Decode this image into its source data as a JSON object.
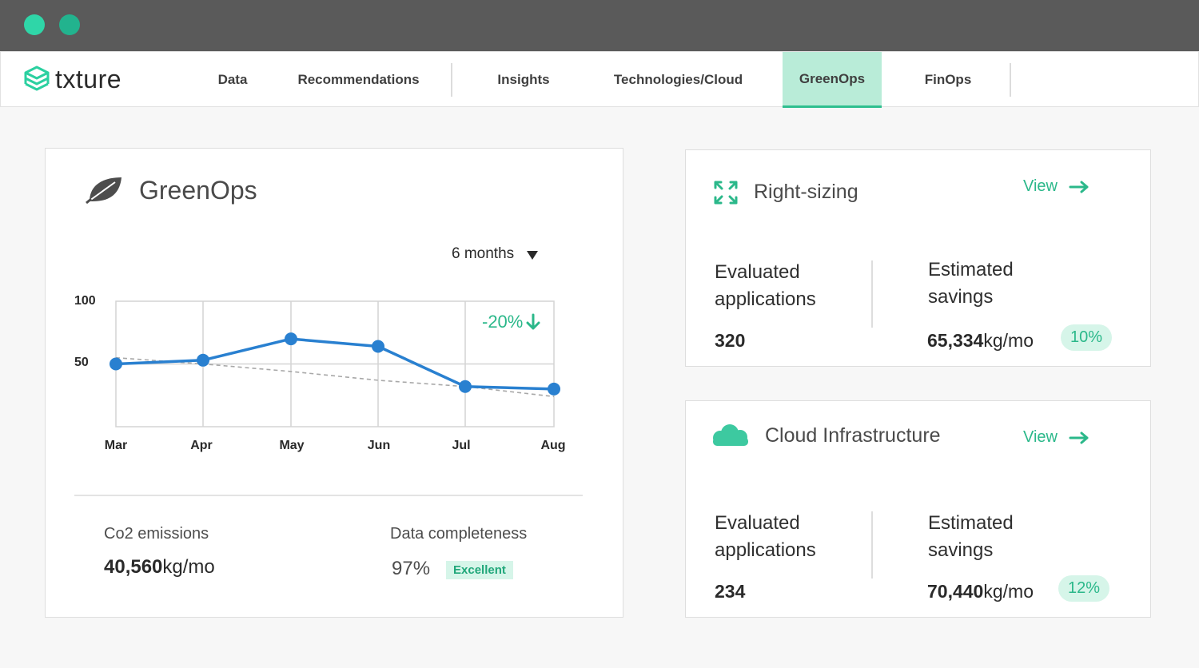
{
  "window": {
    "controls": [
      "window-dot-teal",
      "window-dot-green"
    ]
  },
  "nav": {
    "logo_text": "txture",
    "items": [
      {
        "label": "Data"
      },
      {
        "label": "Recommendations"
      },
      {
        "label": "Insights"
      },
      {
        "label": "Technologies/Cloud"
      },
      {
        "label": "GreenOps",
        "active": true
      },
      {
        "label": "FinOps"
      }
    ]
  },
  "greenops": {
    "title": "GreenOps",
    "period": "6 months",
    "delta": "-20%",
    "co2_label": "Co2 emissions",
    "co2_value": "40,560",
    "co2_unit": "kg/mo",
    "completeness_label": "Data completeness",
    "completeness_value": "97%",
    "completeness_badge": "Excellent"
  },
  "chart_data": {
    "type": "line",
    "categories": [
      "Mar",
      "Apr",
      "May",
      "Jun",
      "Jul",
      "Aug"
    ],
    "series": [
      {
        "values": [
          50,
          53,
          70,
          64,
          32,
          30
        ],
        "color": "#2980d0"
      },
      {
        "values": [
          55,
          50,
          44,
          37,
          32,
          24
        ],
        "style": "dashed-trend",
        "color": "#a8a8a8"
      }
    ],
    "y_ticks": [
      "100",
      "50"
    ],
    "ylim": [
      0,
      100
    ],
    "grid": true
  },
  "rightsizing": {
    "title": "Right-sizing",
    "view_label": "View",
    "evaluated_label": "Evaluated applications",
    "evaluated_value": "320",
    "savings_label": "Estimated savings",
    "savings_value": "65,334",
    "savings_unit": "kg/mo",
    "savings_pct": "10%"
  },
  "cloud": {
    "title": "Cloud Infrastructure",
    "view_label": "View",
    "evaluated_label": "Evaluated applications",
    "evaluated_value": "234",
    "savings_label": "Estimated savings",
    "savings_value": "70,440",
    "savings_unit": "kg/mo",
    "savings_pct": "12%"
  },
  "colors": {
    "accent": "#2bb88a",
    "accent_bg": "#b9ecd8",
    "line": "#2980d0",
    "titlebar": "#5a5a5a"
  }
}
